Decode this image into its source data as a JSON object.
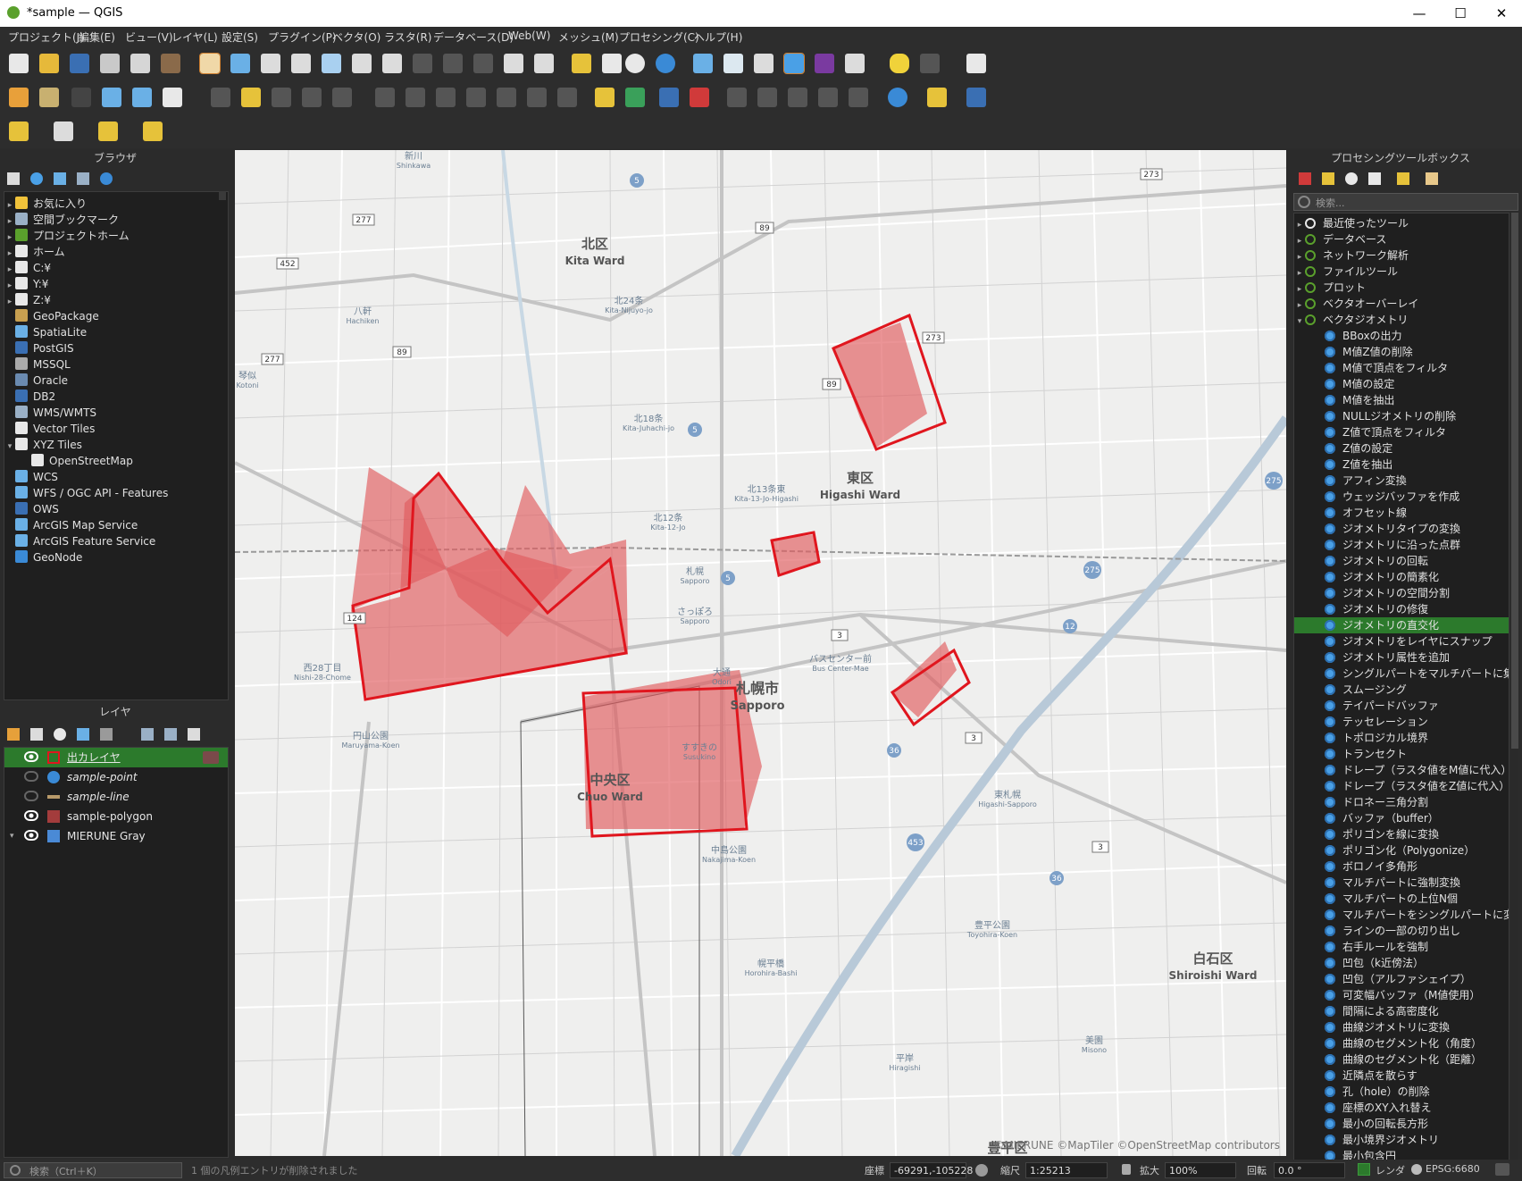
{
  "window": {
    "title": "*sample — QGIS",
    "minimize": "—",
    "maximize": "☐",
    "close": "✕"
  },
  "menu": [
    "プロジェクト(J)",
    "編集(E)",
    "ビュー(V)",
    "レイヤ(L)",
    "設定(S)",
    "プラグイン(P)",
    "ベクタ(O)",
    "ラスタ(R)",
    "データベース(D)",
    "Web(W)",
    "メッシュ(M)",
    "プロセシング(C)",
    "ヘルプ(H)"
  ],
  "browser": {
    "title": "ブラウザ",
    "items": [
      {
        "label": "お気に入り",
        "icon": "star-icon",
        "indent": 0,
        "arrow": "▸"
      },
      {
        "label": "空間ブックマーク",
        "icon": "bookmark-icon",
        "indent": 0,
        "arrow": "▸"
      },
      {
        "label": "プロジェクトホーム",
        "icon": "project-home-icon",
        "indent": 0,
        "arrow": "▸"
      },
      {
        "label": "ホーム",
        "icon": "home-folder-icon",
        "indent": 0,
        "arrow": "▸"
      },
      {
        "label": "C:¥",
        "icon": "drive-icon",
        "indent": 0,
        "arrow": "▸"
      },
      {
        "label": "Y:¥",
        "icon": "drive-icon",
        "indent": 0,
        "arrow": "▸"
      },
      {
        "label": "Z:¥",
        "icon": "drive-icon",
        "indent": 0,
        "arrow": "▸"
      },
      {
        "label": "GeoPackage",
        "icon": "geopackage-icon",
        "indent": 0,
        "arrow": ""
      },
      {
        "label": "SpatiaLite",
        "icon": "spatialite-icon",
        "indent": 0,
        "arrow": ""
      },
      {
        "label": "PostGIS",
        "icon": "postgis-icon",
        "indent": 0,
        "arrow": ""
      },
      {
        "label": "MSSQL",
        "icon": "mssql-icon",
        "indent": 0,
        "arrow": ""
      },
      {
        "label": "Oracle",
        "icon": "oracle-icon",
        "indent": 0,
        "arrow": ""
      },
      {
        "label": "DB2",
        "icon": "db2-icon",
        "indent": 0,
        "arrow": ""
      },
      {
        "label": "WMS/WMTS",
        "icon": "wms-icon",
        "indent": 0,
        "arrow": ""
      },
      {
        "label": "Vector Tiles",
        "icon": "vector-tiles-icon",
        "indent": 0,
        "arrow": ""
      },
      {
        "label": "XYZ Tiles",
        "icon": "xyz-tiles-icon",
        "indent": 0,
        "arrow": "▾"
      },
      {
        "label": "OpenStreetMap",
        "icon": "xyz-tiles-icon",
        "indent": 1,
        "arrow": ""
      },
      {
        "label": "WCS",
        "icon": "wcs-icon",
        "indent": 0,
        "arrow": ""
      },
      {
        "label": "WFS / OGC API - Features",
        "icon": "wfs-icon",
        "indent": 0,
        "arrow": ""
      },
      {
        "label": "OWS",
        "icon": "ows-icon",
        "indent": 0,
        "arrow": ""
      },
      {
        "label": "ArcGIS Map Service",
        "icon": "arcgis-icon",
        "indent": 0,
        "arrow": ""
      },
      {
        "label": "ArcGIS Feature Service",
        "icon": "arcgis-icon",
        "indent": 0,
        "arrow": ""
      },
      {
        "label": "GeoNode",
        "icon": "geonode-icon",
        "indent": 0,
        "arrow": ""
      }
    ]
  },
  "layers": {
    "title": "レイヤ",
    "items": [
      {
        "label": "出カレイヤ",
        "visible": true,
        "selected": true,
        "italic": false,
        "symbol": "outline-red"
      },
      {
        "label": "sample-point",
        "visible": false,
        "selected": false,
        "italic": true,
        "symbol": "point-blue"
      },
      {
        "label": "sample-line",
        "visible": false,
        "selected": false,
        "italic": true,
        "symbol": "line-tan"
      },
      {
        "label": "sample-polygon",
        "visible": true,
        "selected": false,
        "italic": false,
        "symbol": "fill-brown"
      },
      {
        "label": "MIERUNE Gray",
        "visible": true,
        "selected": false,
        "italic": false,
        "symbol": "tile"
      }
    ]
  },
  "toolbox": {
    "title": "プロセシングツールボックス",
    "search_placeholder": "検索...",
    "groups": [
      {
        "label": "最近使ったツール",
        "icon": "clock-icon"
      },
      {
        "label": "データベース",
        "icon": "qgis-icon"
      },
      {
        "label": "ネットワーク解析",
        "icon": "qgis-icon"
      },
      {
        "label": "ファイルツール",
        "icon": "qgis-icon"
      },
      {
        "label": "プロット",
        "icon": "qgis-icon"
      },
      {
        "label": "ベクタオーバーレイ",
        "icon": "qgis-icon"
      },
      {
        "label": "ベクタジオメトリ",
        "icon": "qgis-icon"
      }
    ],
    "tools": [
      "BBoxの出力",
      "M値Z値の削除",
      "M値で頂点をフィルタ",
      "M値の設定",
      "M値を抽出",
      "NULLジオメトリの削除",
      "Z値で頂点をフィルタ",
      "Z値の設定",
      "Z値を抽出",
      "アフィン変換",
      "ウェッジバッファを作成",
      "オフセット線",
      "ジオメトリタイプの変換",
      "ジオメトリに沿った点群",
      "ジオメトリの回転",
      "ジオメトリの簡素化",
      "ジオメトリの空間分割",
      "ジオメトリの修復",
      "ジオメトリの直交化",
      "ジオメトリをレイヤにスナップ",
      "ジオメトリ属性を追加",
      "シングルパートをマルチパートに集約",
      "スムージング",
      "テイパードバッファ",
      "テッセレーション",
      "トポロジカル境界",
      "トランセクト",
      "ドレープ（ラスタ値をM値に代入）",
      "ドレープ（ラスタ値をZ値に代入）",
      "ドロネー三角分割",
      "バッファ（buffer）",
      "ポリゴンを線に変換",
      "ポリゴン化（Polygonize）",
      "ボロノイ多角形",
      "マルチパートに強制変換",
      "マルチパートの上位N個",
      "マルチパートをシングルパートに変換",
      "ラインの一部の切り出し",
      "右手ルールを強制",
      "凹包（k近傍法）",
      "凹包（アルファシェイプ）",
      "可変幅バッファ（M値使用）",
      "間隔による高密度化",
      "曲線ジオメトリに変換",
      "曲線のセグメント化（角度）",
      "曲線のセグメント化（距離）",
      "近隣点を散らす",
      "孔（hole）の削除",
      "座標のXY入れ替え",
      "最小の回転長方形",
      "最小境界ジオメトリ",
      "最小包含円"
    ],
    "selected_tool": "ジオメトリの直交化"
  },
  "map": {
    "attribution": "©MIERUNE ©MapTiler ©OpenStreetMap contributors",
    "districts": [
      {
        "jp": "北区",
        "en": "Kita Ward"
      },
      {
        "jp": "東区",
        "en": "Higashi Ward"
      },
      {
        "jp": "中央区",
        "en": "Chuo Ward"
      },
      {
        "jp": "白石区",
        "en": "Shiroishi Ward"
      },
      {
        "jp": "豊平区",
        "en": ""
      }
    ],
    "city": {
      "jp": "札幌市",
      "en": "Sapporo"
    },
    "stations": [
      {
        "jp": "北24条",
        "en": "Kita-Nijuyo-jo"
      },
      {
        "jp": "北18条",
        "en": "Kita-Juhachi-jo"
      },
      {
        "jp": "北13条東",
        "en": "Kita-13-Jo-Higashi"
      },
      {
        "jp": "北12条",
        "en": "Kita-12-Jo"
      },
      {
        "jp": "札幌",
        "en": "Sapporo"
      },
      {
        "jp": "さっぽろ",
        "en": "Sapporo"
      },
      {
        "jp": "大通",
        "en": "Odori"
      },
      {
        "jp": "バスセンター前",
        "en": "Bus Center-Mae"
      },
      {
        "jp": "西28丁目",
        "en": "Nishi-28-Chome"
      },
      {
        "jp": "円山公園",
        "en": "Maruyama-Koen"
      },
      {
        "jp": "すすきの",
        "en": "Susukino"
      },
      {
        "jp": "中島公園",
        "en": "Nakajima-Koen"
      },
      {
        "jp": "幌平橋",
        "en": "Horohira-Bashi"
      },
      {
        "jp": "東札幌",
        "en": "Higashi-Sapporo"
      },
      {
        "jp": "豊平公園",
        "en": "Toyohira-Koen"
      },
      {
        "jp": "八軒",
        "en": "Hachiken"
      },
      {
        "jp": "琴似",
        "en": "Kotoni"
      },
      {
        "jp": "新川",
        "en": "Shinkawa"
      },
      {
        "jp": "平岸",
        "en": "Hiragishi"
      },
      {
        "jp": "美園",
        "en": "Misono"
      }
    ],
    "route_shields": [
      "5",
      "89",
      "277",
      "452",
      "273",
      "275",
      "12",
      "36",
      "453",
      "3",
      "124"
    ],
    "polygon_fill": "#e05a5e",
    "outline_color": "#e0161e"
  },
  "status": {
    "search_placeholder": "検索（Ctrl＋K）",
    "message": "1 個の凡例エントリが削除されました",
    "coord_label": "座標",
    "coord_value": "-69291,-105228",
    "scale_label": "縮尺",
    "scale_value": "1:25213",
    "magnifier_label": "拡大",
    "magnifier_value": "100%",
    "rotation_label": "回転",
    "rotation_value": "0.0 °",
    "render_label": "レンダ",
    "crs": "EPSG:6680"
  },
  "colors": {
    "accent": "#2c7a2c",
    "panel_bg": "#1f1f1f",
    "chrome_bg": "#2d2d2d"
  }
}
